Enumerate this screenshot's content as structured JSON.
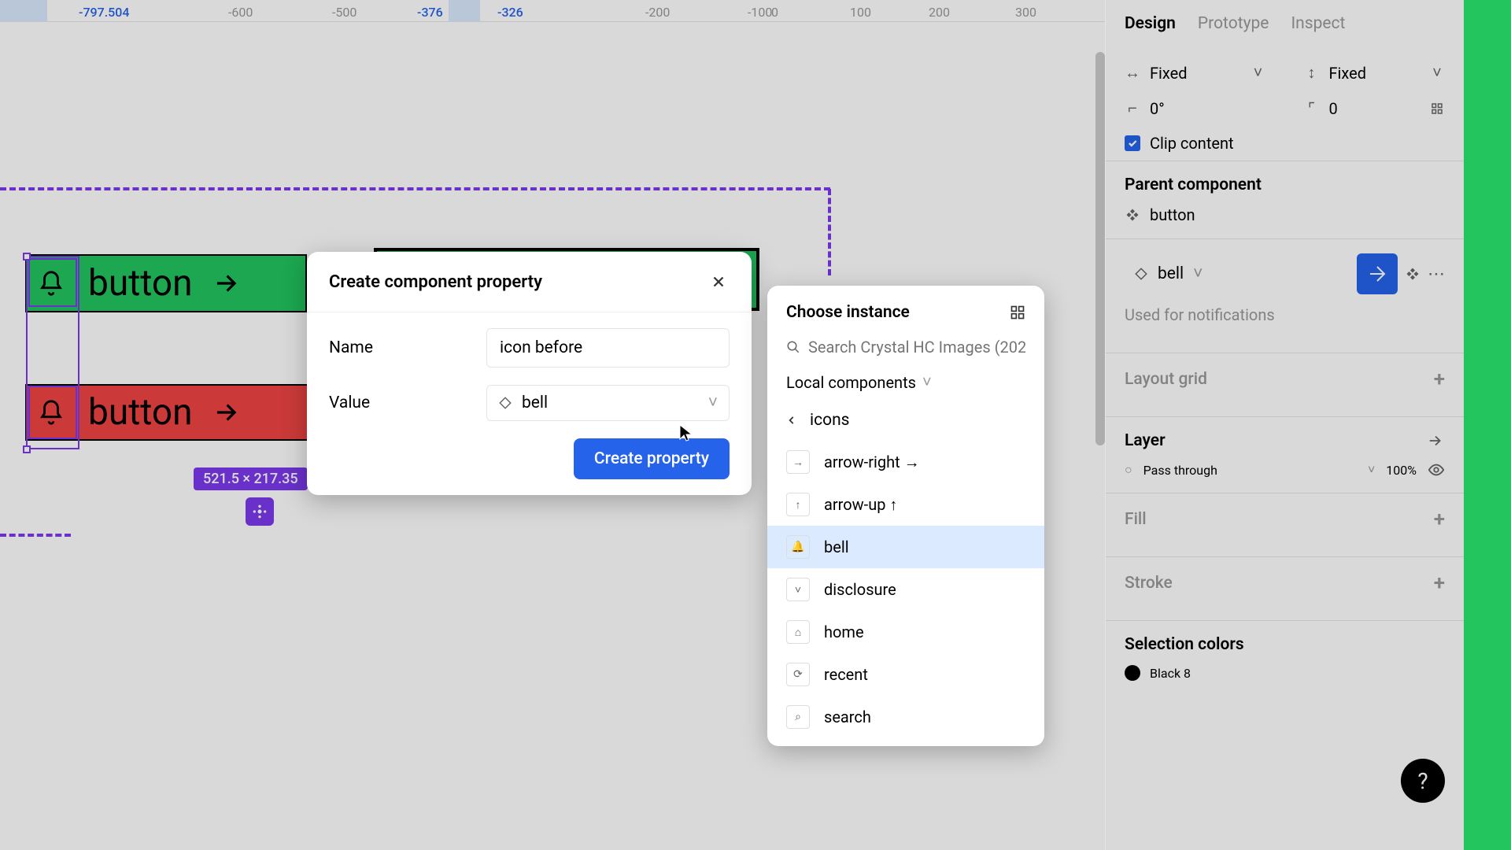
{
  "ruler": {
    "ticks": [
      {
        "pos": 100,
        "label": "-797.504",
        "blue": true
      },
      {
        "pos": 290,
        "label": "-600"
      },
      {
        "pos": 422,
        "label": "-500"
      },
      {
        "pos": 530,
        "label": "-376",
        "blue": true
      },
      {
        "pos": 632,
        "label": "-326",
        "blue": true
      },
      {
        "pos": 820,
        "label": "-200"
      },
      {
        "pos": 950,
        "label": "-100"
      },
      {
        "pos": 980,
        "label": "0"
      },
      {
        "pos": 1080,
        "label": "100"
      },
      {
        "pos": 1180,
        "label": "200"
      },
      {
        "pos": 1290,
        "label": "300"
      }
    ]
  },
  "canvas": {
    "button_label": "button",
    "dimension_badge": "521.5 × 217.35"
  },
  "modal": {
    "title": "Create component property",
    "name_label": "Name",
    "name_value": "icon before",
    "value_label": "Value",
    "value_selected": "bell",
    "submit_label": "Create property"
  },
  "picker": {
    "title": "Choose instance",
    "search_placeholder": "Search Crystal HC Images (202…",
    "scope_label": "Local components",
    "back_label": "icons",
    "items": [
      {
        "name": "arrow-right",
        "glyph": "→",
        "suffix": " →"
      },
      {
        "name": "arrow-up",
        "glyph": "↑",
        "suffix": " ↑"
      },
      {
        "name": "bell",
        "glyph": "🔔",
        "suffix": "",
        "selected": true
      },
      {
        "name": "disclosure",
        "glyph": "˅",
        "suffix": ""
      },
      {
        "name": "home",
        "glyph": "⌂",
        "suffix": ""
      },
      {
        "name": "recent",
        "glyph": "⟳",
        "suffix": ""
      },
      {
        "name": "search",
        "glyph": "⌕",
        "suffix": ""
      }
    ]
  },
  "panel": {
    "tabs": {
      "design": "Design",
      "prototype": "Prototype",
      "inspect": "Inspect"
    },
    "h_constraint": "Fixed",
    "v_constraint": "Fixed",
    "rotation": "0°",
    "corner": "0",
    "clip_label": "Clip content",
    "parent_title": "Parent component",
    "parent_name": "button",
    "instance_name": "bell",
    "instance_desc": "Used for notifications",
    "layout_grid": "Layout grid",
    "layer_title": "Layer",
    "blend_mode": "Pass through",
    "opacity": "100%",
    "fill_title": "Fill",
    "stroke_title": "Stroke",
    "selection_colors": "Selection colors",
    "color1_name": "Black 8"
  }
}
